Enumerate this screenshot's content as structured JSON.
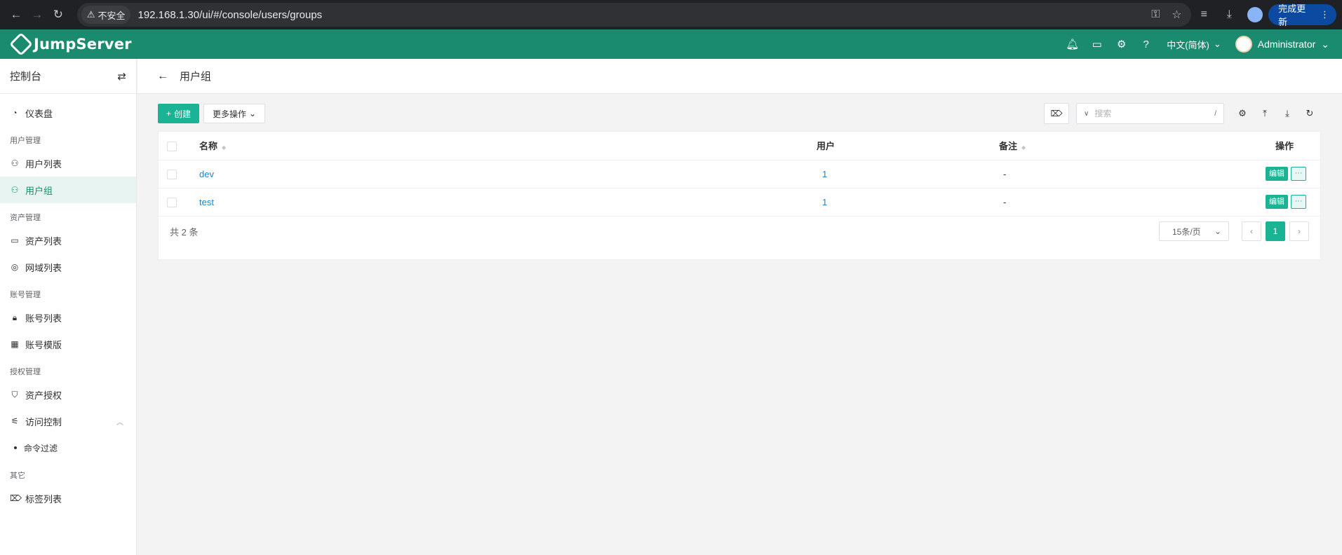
{
  "browser": {
    "security_label": "不安全",
    "url": "192.168.1.30/ui/#/console/users/groups",
    "update_label": "完成更新"
  },
  "header": {
    "logo": "JumpServer",
    "language": "中文(简体)",
    "user": "Administrator"
  },
  "sidebar": {
    "title": "控制台",
    "dashboard": "仪表盘",
    "groups": [
      {
        "title": "用户管理",
        "items": [
          "用户列表",
          "用户组"
        ]
      },
      {
        "title": "资产管理",
        "items": [
          "资产列表",
          "网域列表"
        ]
      },
      {
        "title": "账号管理",
        "items": [
          "账号列表",
          "账号模版"
        ]
      },
      {
        "title": "授权管理",
        "items": [
          "资产授权",
          "访问控制"
        ]
      },
      {
        "title": "其它",
        "items": [
          "标签列表"
        ]
      }
    ],
    "access_control_sub": "命令过滤"
  },
  "page": {
    "title": "用户组"
  },
  "toolbar": {
    "create": "创建",
    "more_actions": "更多操作",
    "search_placeholder": "搜索",
    "search_shortcut": "/"
  },
  "table": {
    "columns": {
      "name": "名称",
      "users": "用户",
      "comment": "备注",
      "actions": "操作"
    },
    "rows": [
      {
        "name": "dev",
        "users": "1",
        "comment": "-",
        "edit": "编辑",
        "more": "···"
      },
      {
        "name": "test",
        "users": "1",
        "comment": "-",
        "edit": "编辑",
        "more": "···"
      }
    ]
  },
  "pagination": {
    "total": "共 2 条",
    "page_size": "15条/页",
    "current_page": "1"
  },
  "colors": {
    "brand": "#1b8b6f",
    "primary": "#1ab394",
    "link": "#1c84c6"
  }
}
